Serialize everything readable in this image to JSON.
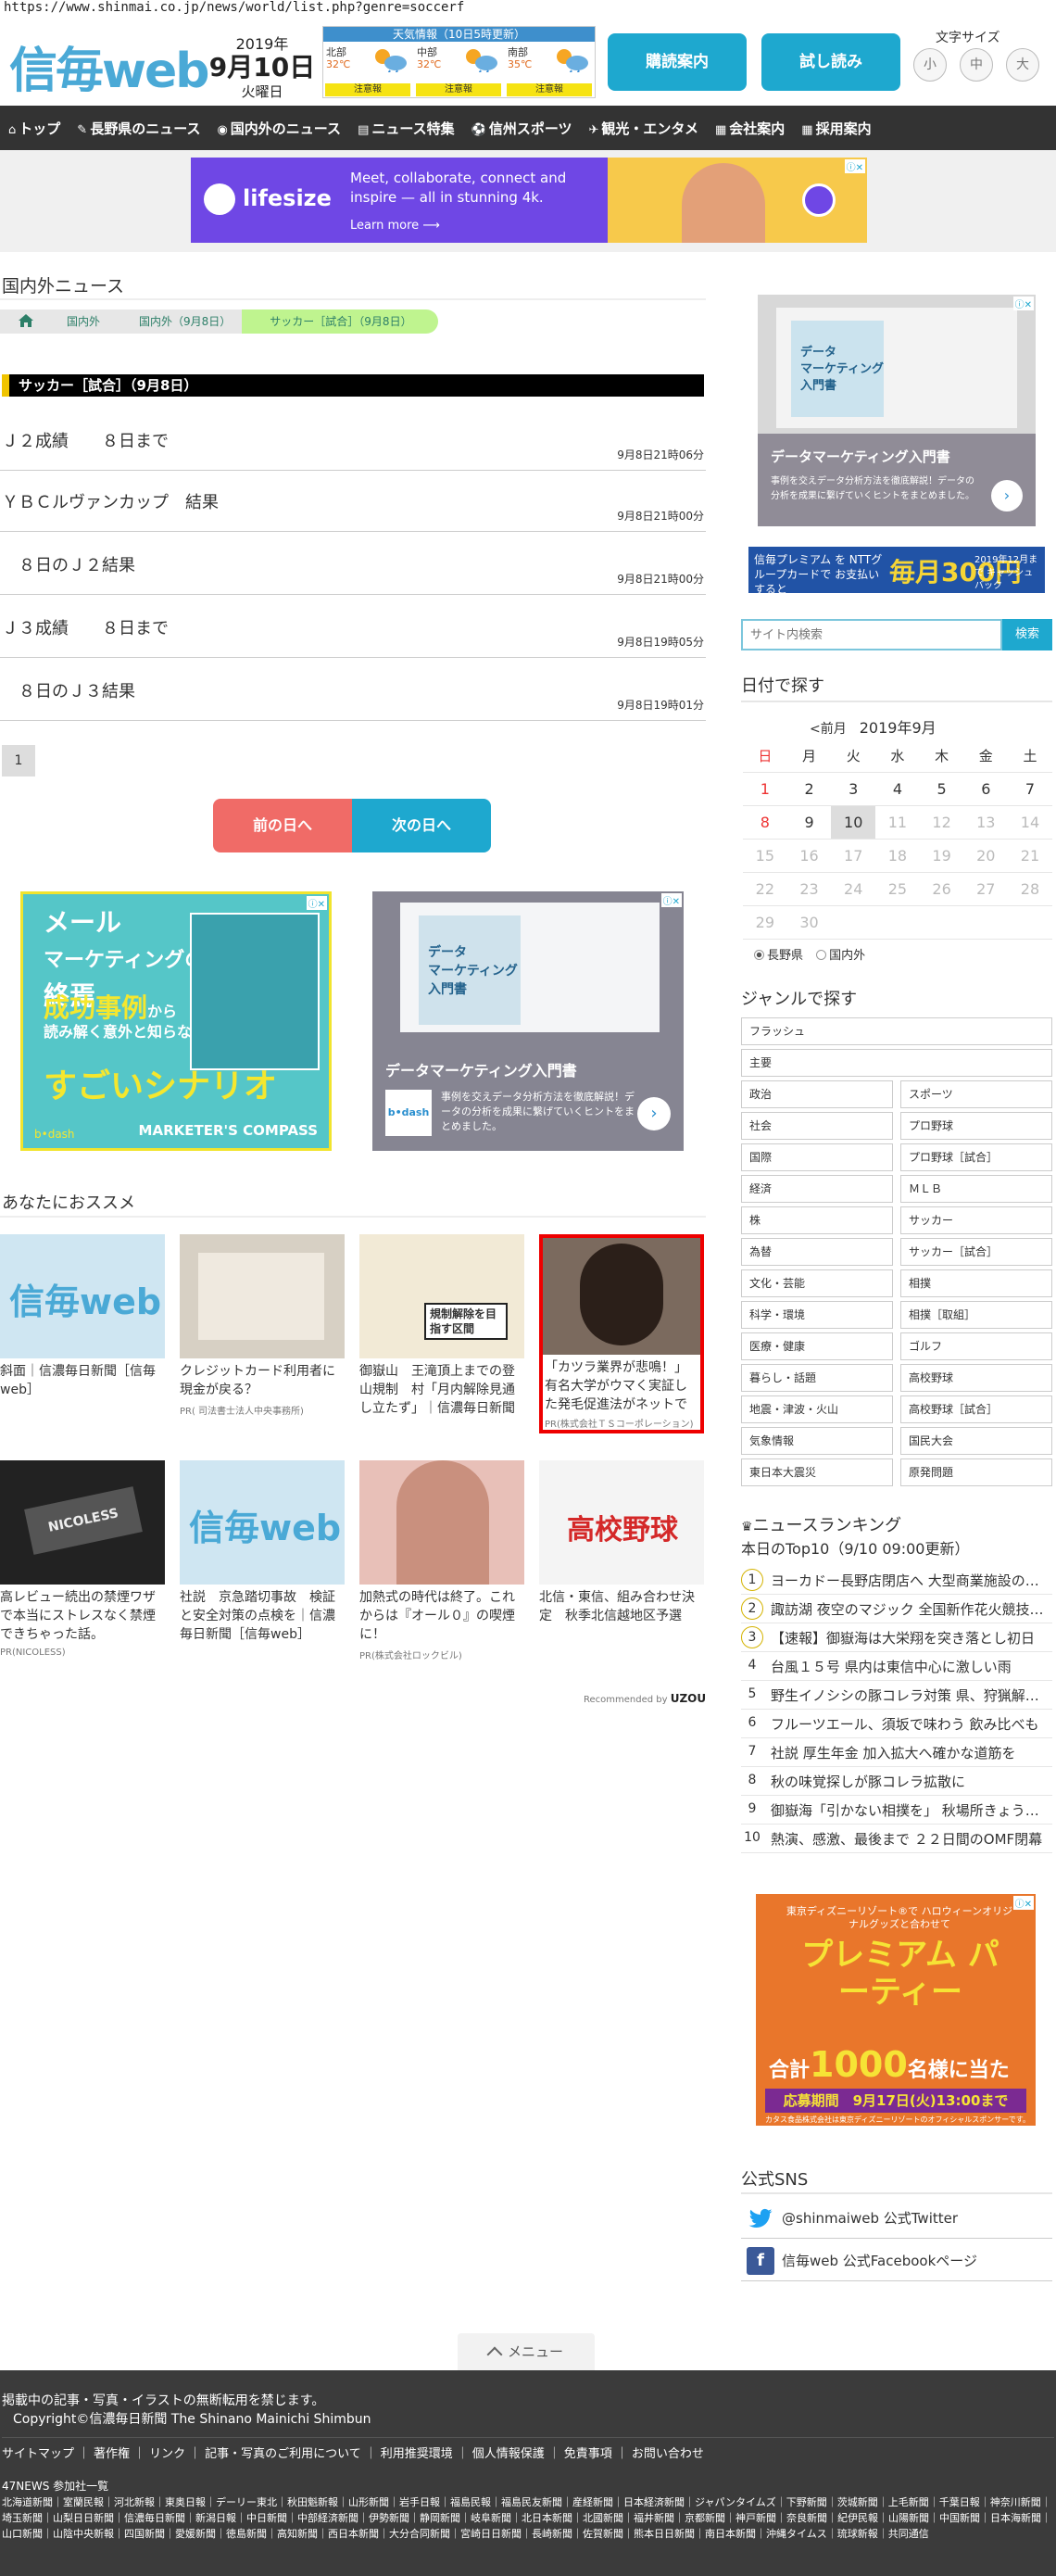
{
  "browser": {
    "url": "https://www.shinmai.co.jp/news/world/list.php?genre=soccerf"
  },
  "header": {
    "logo": "信毎web",
    "date": {
      "year": "2019年",
      "monthday": "9月10日",
      "weekday": "火曜日"
    },
    "weather": {
      "title": "天気情報（10日5時更新）",
      "regions": [
        {
          "name": "北部",
          "temp": "32℃",
          "warn": "注意報"
        },
        {
          "name": "中部",
          "temp": "32℃",
          "warn": "注意報"
        },
        {
          "name": "南部",
          "temp": "35℃",
          "warn": "注意報"
        }
      ]
    },
    "subscribe_label": "購読案内",
    "trial_label": "試し読み",
    "fontsize_label": "文字サイズ",
    "fontsizes": [
      "小",
      "中",
      "大"
    ]
  },
  "nav": [
    {
      "glyph": "⌂",
      "label": "トップ"
    },
    {
      "glyph": "✎",
      "label": "長野県のニュース"
    },
    {
      "glyph": "◉",
      "label": "国内外のニュース"
    },
    {
      "glyph": "▤",
      "label": "ニュース特集"
    },
    {
      "glyph": "⚽",
      "label": "信州スポーツ"
    },
    {
      "glyph": "✈",
      "label": "観光・エンタメ"
    },
    {
      "glyph": "▦",
      "label": "会社案内"
    },
    {
      "glyph": "▦",
      "label": "採用案内"
    }
  ],
  "banner_ad": {
    "brand": "lifesize",
    "text": "Meet, collaborate, connect and inspire — all in stunning 4k.",
    "learn": "Learn more ⟶"
  },
  "main": {
    "section_title": "国内外ニュース",
    "breadcrumbs": [
      "国内外",
      "国内外（9月8日）",
      "サッカー［試合］（9月8日）"
    ],
    "subhead": "サッカー［試合］（9月8日）",
    "news": [
      {
        "title": "Ｊ２成績　　８日まで",
        "time": "9月8日21時06分"
      },
      {
        "title": "ＹＢＣルヴァンカップ　結果",
        "time": "9月8日21時00分"
      },
      {
        "title": "　８日のＪ２結果",
        "time": "9月8日21時00分"
      },
      {
        "title": "Ｊ３成績　　８日まで",
        "time": "9月8日19時05分"
      },
      {
        "title": "　８日のＪ３結果",
        "time": "9月8日19時01分"
      }
    ],
    "page": "1",
    "prev_label": "前の日へ",
    "next_label": "次の日へ"
  },
  "ads": {
    "marketers": {
      "line1": "メール",
      "line2": "マーケティングの",
      "line3": "終焉",
      "em": "成功事例",
      "sub1": "から",
      "sub2": "読み解く意外と知らない",
      "big": "すごいシナリオ",
      "brand": "MARKETER'S COMPASS",
      "by": "b•dash"
    },
    "datamk": {
      "book": "データ\nマーケティング\n入門書",
      "title": "データマーケティング入門書",
      "desc": "事例を交えデータ分析方法を徹底解説！データの分析を成果に繋げていくヒントをまとめました。",
      "logo": "b•dash"
    },
    "premium": {
      "left": "信毎プレミアム を NTTグループカードで お支払いすると",
      "big": "毎月300円",
      "small": "2019年12月まで キャッシュバック"
    },
    "disney": {
      "top": "東京ディズニーリゾート®で ハロウィーンオリジナルグッズと合わせて",
      "title": "プレミアム パーティー",
      "count_pre": "合計",
      "count": "1000",
      "count_post": "名様に当たる!",
      "deadline": "応募期間　9月17日(火)13:00まで",
      "note": "カタス食品株式会社は東京ディズニーリゾートのオフィシャルスポンサーです。"
    }
  },
  "recommend": {
    "title": "あなたにおススメ",
    "items": [
      {
        "caption": "斜面｜信濃毎日新聞［信毎web］",
        "pr": ""
      },
      {
        "caption": "クレジットカード利用者に現金が戻る？",
        "pr": "PR( 司法書士法人中央事務所)"
      },
      {
        "caption": "御嶽山　王滝頂上までの登山規制　村「月内解除見通し立たず」｜信濃毎日新聞［信毎web］",
        "pr": ""
      },
      {
        "caption": "「カツラ業界が悲鳴！」有名大学がウマく実証した発毛促進法がネットで話題",
        "pr": "PR(株式会社ＴＳコーポレーション)"
      },
      {
        "caption": "高レビュー続出の禁煙ワザで本当にストレスなく禁煙できちゃった話。",
        "pr": "PR(NICOLESS)"
      },
      {
        "caption": "社説　京急踏切事故　検証と安全対策の点検を｜信濃毎日新聞［信毎web］",
        "pr": ""
      },
      {
        "caption": "加熱式の時代は終了。これからは『オール０』の喫煙に！",
        "pr": "PR(株式会社ロックビル)"
      },
      {
        "caption": "北信・東信、組み合わせ決定　秋季北信越地区予選",
        "pr": ""
      }
    ],
    "thumbs": {
      "logo": "信毎web",
      "map": "規制解除を目指す区間",
      "baseball": "高校野球",
      "nicoless": "NICOLESS"
    },
    "recommended_by": "Recommended by",
    "uzou": "UZOU"
  },
  "sidebar": {
    "search_placeholder": "サイト内検索",
    "search_btn": "検索",
    "date_title": "日付で探す",
    "cal_prev": "<前月",
    "cal_month": "2019年9月",
    "weekdays": [
      "日",
      "月",
      "火",
      "水",
      "木",
      "金",
      "土"
    ],
    "weeks": [
      [
        "1",
        "2",
        "3",
        "4",
        "5",
        "6",
        "7"
      ],
      [
        "8",
        "9",
        "10",
        "11",
        "12",
        "13",
        "14"
      ],
      [
        "15",
        "16",
        "17",
        "18",
        "19",
        "20",
        "21"
      ],
      [
        "22",
        "23",
        "24",
        "25",
        "26",
        "27",
        "28"
      ],
      [
        "29",
        "30",
        "",
        "",
        "",
        "",
        ""
      ]
    ],
    "today": "10",
    "radio": [
      "長野県",
      "国内外"
    ],
    "genre_title": "ジャンルで探す",
    "genre_full": [
      "フラッシュ",
      "主要"
    ],
    "genre_pairs": [
      [
        "政治",
        "スポーツ"
      ],
      [
        "社会",
        "プロ野球"
      ],
      [
        "国際",
        "プロ野球［試合］"
      ],
      [
        "経済",
        "ＭＬＢ"
      ],
      [
        "株",
        "サッカー"
      ],
      [
        "為替",
        "サッカー［試合］"
      ],
      [
        "文化・芸能",
        "相撲"
      ],
      [
        "科学・環境",
        "相撲［取組］"
      ],
      [
        "医療・健康",
        "ゴルフ"
      ],
      [
        "暮らし・話題",
        "高校野球"
      ],
      [
        "地震・津波・火山",
        "高校野球［試合］"
      ],
      [
        "気象情報",
        "国民大会"
      ],
      [
        "東日本大震災",
        "原発問題"
      ]
    ],
    "ranking_title": "ニュースランキング",
    "ranking_sub": "本日のTop10（9/10 09:00更新）",
    "ranking": [
      "ヨーカドー長野店閉店へ 大型商業施設の撤退続く",
      "諏訪湖 夜空のマジック 全国新作花火競技大会",
      "【速報】御嶽海は大栄翔を突き落とし初日",
      "台風１５号 県内は東信中心に激しい雨",
      "野生イノシシの豚コレラ対策 県、狩猟解禁へ",
      "フルーツエール、須坂で味わう 飲み比べも",
      "社説 厚生年金 加入拡大へ確かな道筋を",
      "秋の味覚探しが豚コレラ拡散に",
      "御嶽海「引かない相撲を」 秋場所きょう初日",
      "熱演、感激、最後まで ２２日間のOMF閉幕"
    ],
    "sns_title": "公式SNS",
    "sns": [
      "@shinmaiweb 公式Twitter",
      "信毎web 公式Facebookページ"
    ]
  },
  "menu_label": "メニュー",
  "footer": {
    "copy1": "掲載中の記事・写真・イラストの無断転用を禁じます。",
    "copy2": "Copyright©信濃毎日新聞 The Shinano Mainichi Shimbun",
    "links": [
      "サイトマップ",
      "著作権",
      "リンク",
      "記事・写真のご利用について",
      "利用推奨環境",
      "個人情報保護",
      "免責事項",
      "お問い合わせ"
    ],
    "news47": "47NEWS 参加社一覧",
    "papers": "北海道新聞｜室蘭民報｜河北新報｜東奥日報｜デーリー東北｜秋田魁新報｜山形新聞｜岩手日報｜福島民報｜福島民友新聞｜産経新聞｜日本経済新聞｜ジャパンタイムズ｜下野新聞｜茨城新聞｜上毛新聞｜千葉日報｜神奈川新聞｜埼玉新聞｜山梨日日新聞｜信濃毎日新聞｜新潟日報｜中日新聞｜中部経済新聞｜伊勢新聞｜静岡新聞｜岐阜新聞｜北日本新聞｜北國新聞｜福井新聞｜京都新聞｜神戸新聞｜奈良新聞｜紀伊民報｜山陽新聞｜中国新聞｜日本海新聞｜山口新聞｜山陰中央新報｜四国新聞｜愛媛新聞｜徳島新聞｜高知新聞｜西日本新聞｜大分合同新聞｜宮崎日日新聞｜長崎新聞｜佐賀新聞｜熊本日日新聞｜南日本新聞｜沖縄タイムス｜琉球新報｜共同通信"
  },
  "colors": {
    "accent": "#1ea8cf",
    "nav": "#333333",
    "prev": "#f06b67",
    "crumb_active": "#bff48f",
    "footer": "#3b3b3b"
  }
}
